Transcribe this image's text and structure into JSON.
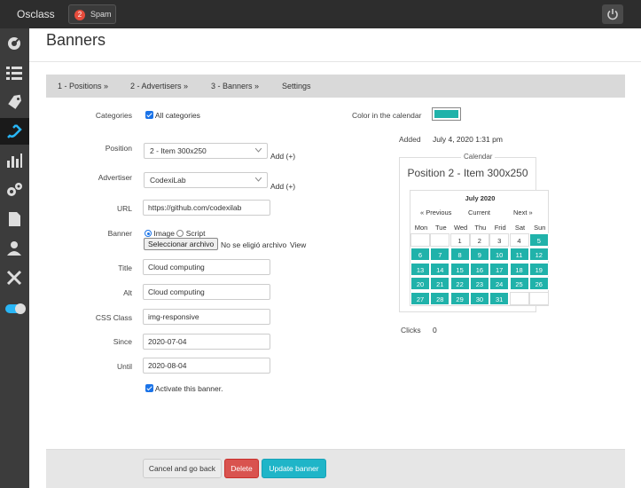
{
  "header": {
    "brand": "Osclass",
    "spam_count": "2",
    "spam_label": "Spam"
  },
  "sidebar": {
    "items": [
      "dashboard-icon",
      "list-icon",
      "tag-icon",
      "plug-icon",
      "chart-icon",
      "gears-icon",
      "page-icon",
      "user-icon",
      "tools-icon",
      "toggle-icon"
    ]
  },
  "page": {
    "title": "Banners"
  },
  "tabs": [
    "1 - Positions »",
    "2 - Advertisers »",
    "3 - Banners »",
    "Settings"
  ],
  "form": {
    "categories_label": "Categories",
    "all_categories": "All categories",
    "position_label": "Position",
    "position_value": "2 - Item 300x250",
    "add_link": "Add (+)",
    "advertiser_label": "Advertiser",
    "advertiser_value": "CodexiLab",
    "url_label": "URL",
    "url_value": "https://github.com/codexilab",
    "banner_label": "Banner",
    "opt_image": "Image",
    "opt_script": "Script",
    "file_button": "Seleccionar archivo",
    "file_status": "No se eligió archivo",
    "view_link": "View",
    "title_label": "Title",
    "title_value": "Cloud computing",
    "alt_label": "Alt",
    "alt_value": "Cloud computing",
    "css_label": "CSS Class",
    "css_value": "img-responsive",
    "since_label": "Since",
    "since_value": "2020-07-04",
    "until_label": "Until",
    "until_value": "2020-08-04",
    "activate_label": "Activate this banner."
  },
  "right": {
    "color_label": "Color in the calendar",
    "color_value": "#20b2aa",
    "added_label": "Added",
    "added_value": "July 4, 2020 1:31 pm",
    "calendar_legend": "Calendar",
    "calendar_title": "Position 2 - Item 300x250",
    "month": "July 2020",
    "prev": "« Previous",
    "current": "Current",
    "next": "Next »",
    "dow": [
      "Mon",
      "Tue",
      "Wed",
      "Thu",
      "Frid",
      "Sat",
      "Sun"
    ],
    "weeks": [
      [
        "",
        "",
        "1",
        "2",
        "3",
        "4",
        "5"
      ],
      [
        "6",
        "7",
        "8",
        "9",
        "10",
        "11",
        "12"
      ],
      [
        "13",
        "14",
        "15",
        "16",
        "17",
        "18",
        "19"
      ],
      [
        "20",
        "21",
        "22",
        "23",
        "24",
        "25",
        "26"
      ],
      [
        "27",
        "28",
        "29",
        "30",
        "31",
        "",
        ""
      ]
    ],
    "selected_from": 5,
    "clicks_label": "Clicks",
    "clicks_value": "0"
  },
  "footer": {
    "cancel": "Cancel and go back",
    "delete": "Delete",
    "update": "Update banner"
  }
}
